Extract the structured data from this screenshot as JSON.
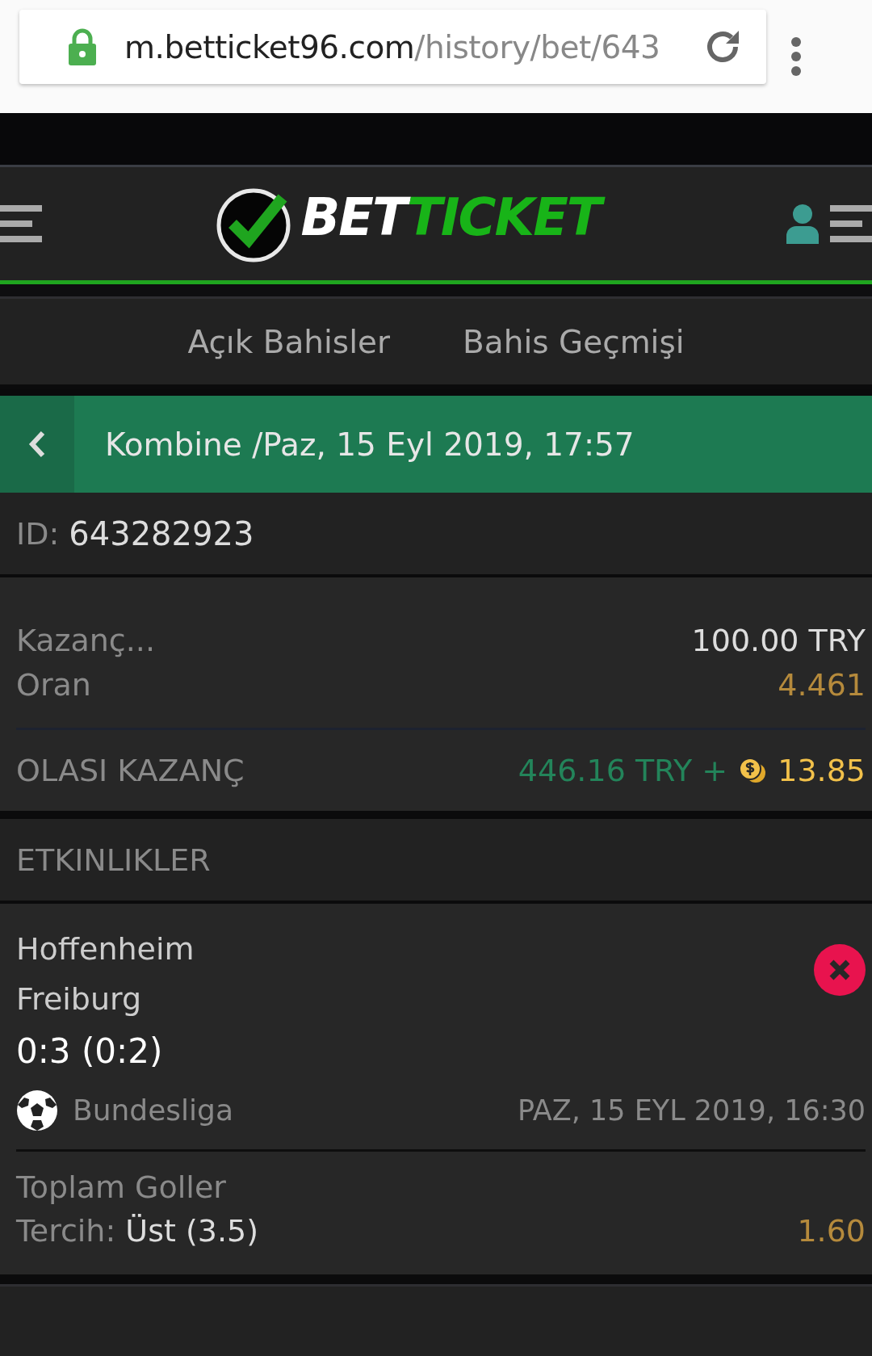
{
  "browser": {
    "url_host": "m.betticket96.com",
    "url_path": "/history/bet/643"
  },
  "header": {
    "logo": {
      "part_1": "BET",
      "part_2": "TICKET"
    }
  },
  "tabs": [
    {
      "label": "Açık Bahisler",
      "selected": false
    },
    {
      "label": "Bahis Geçmişi",
      "selected": false
    }
  ],
  "title_bar": {
    "title": "Kombine /Paz, 15 Eyl 2019, 17:57"
  },
  "ticket_id": {
    "label": "ID:",
    "value": "643282923"
  },
  "summary": {
    "stake_label": "Kazanç...",
    "stake_value": "100.00 TRY",
    "odds_label": "Oran",
    "odds_value": "4.461",
    "potential_label": "OLASI KAZANÇ",
    "potential_value": "446.16 TRY +",
    "bonus_value": "13.85"
  },
  "events_heading": "ETKINLIKLER",
  "events": [
    {
      "home": "Hoffenheim",
      "away": "Freiburg",
      "score": "0:3 (0:2)",
      "kind": "lost",
      "league": "Bundesliga",
      "date": "PAZ, 15 EYL 2019, 16:30",
      "market": "Toplam Goller",
      "pick_label": "Tercih:",
      "pick_value": "Üst (3.5)",
      "odds": "1.60"
    }
  ]
}
